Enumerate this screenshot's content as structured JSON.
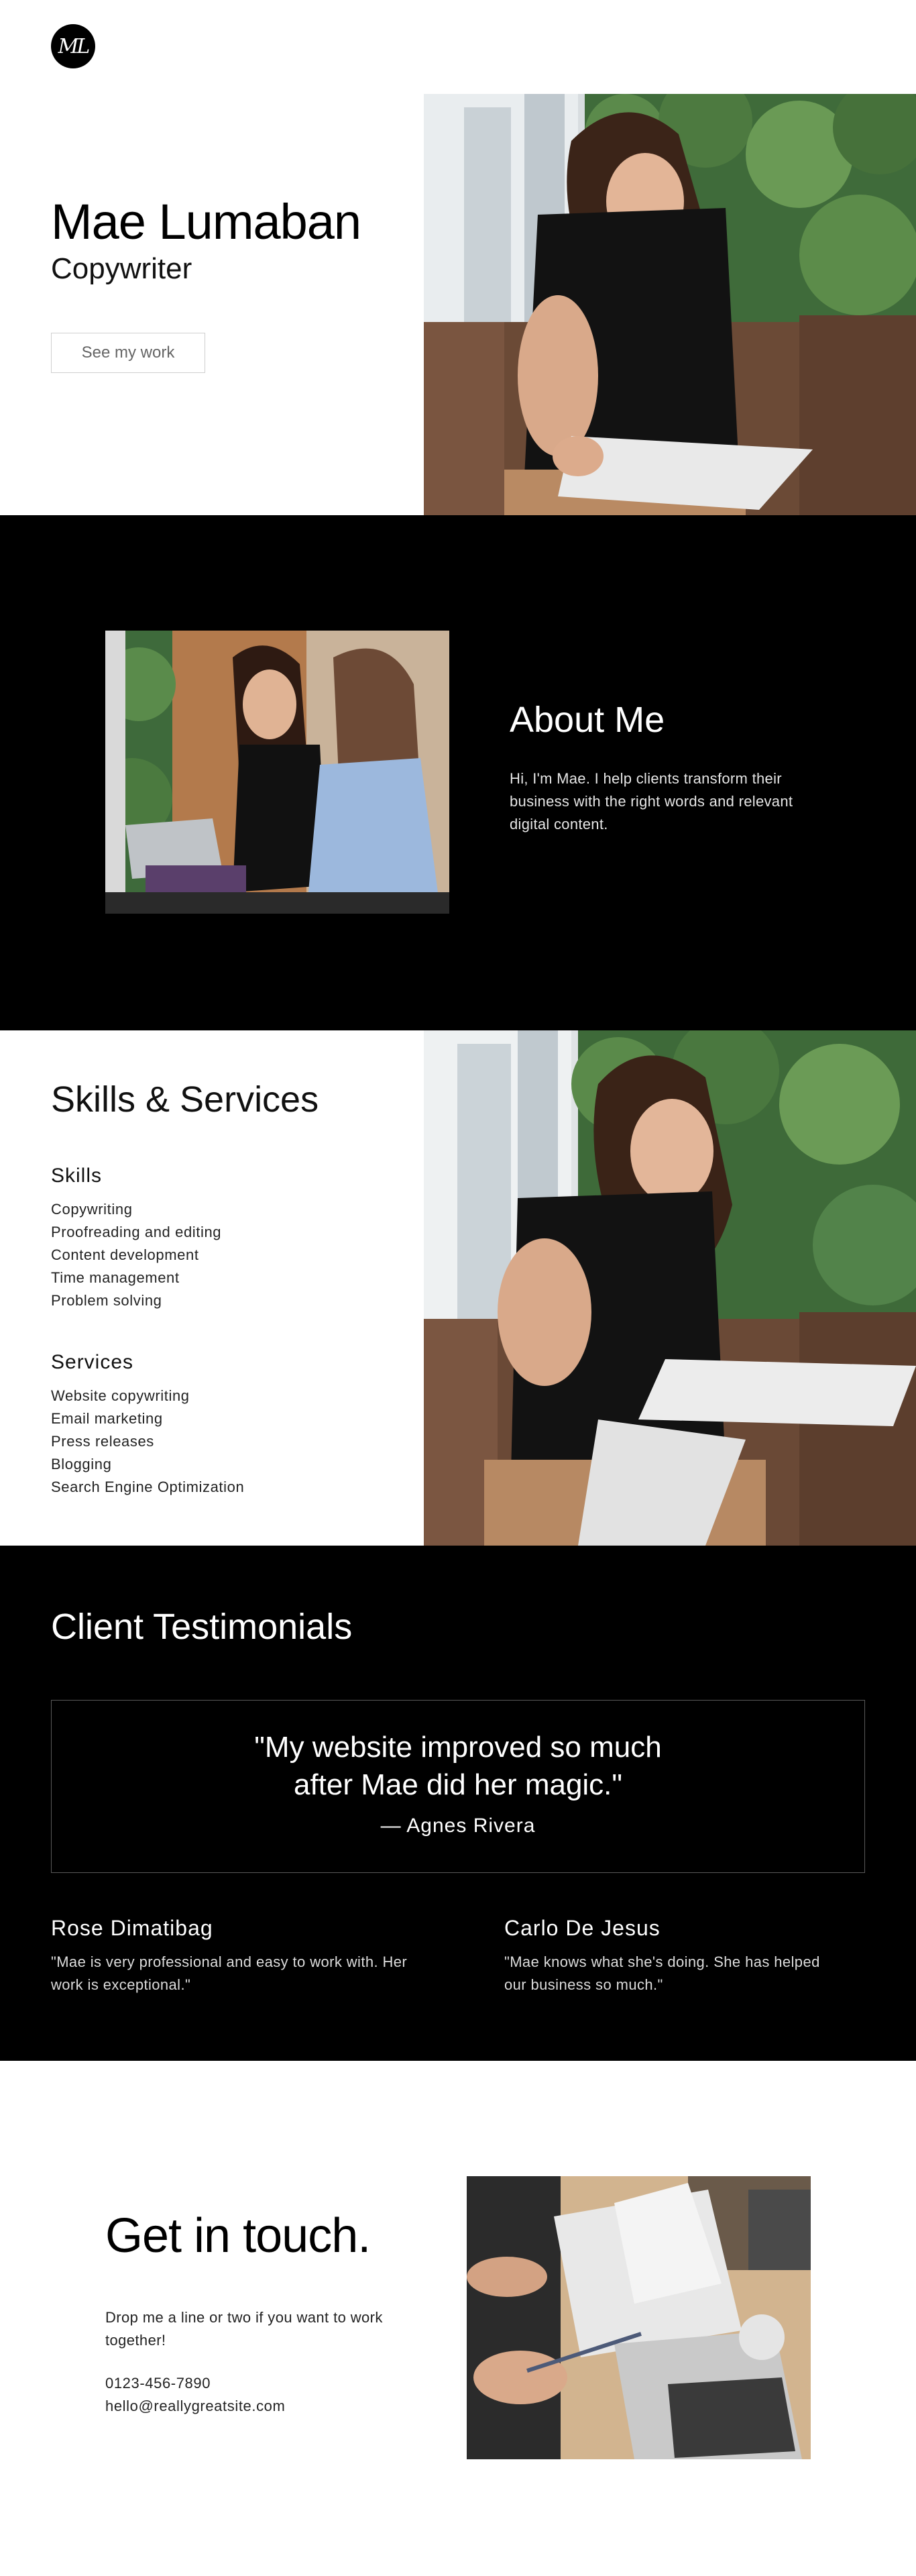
{
  "logo": {
    "monogram": "ML"
  },
  "hero": {
    "name": "Mae Lumaban",
    "role": "Copywriter",
    "button_label": "See my work"
  },
  "about": {
    "title": "About Me",
    "text": "Hi, I'm Mae. I help clients transform their business with the right words and relevant digital content."
  },
  "skills": {
    "title": "Skills & Services",
    "skills_heading": "Skills",
    "skills_list": [
      "Copywriting",
      "Proofreading and editing",
      "Content development",
      "Time management",
      "Problem solving"
    ],
    "services_heading": "Services",
    "services_list": [
      "Website copywriting",
      "Email marketing",
      "Press releases",
      "Blogging",
      "Search Engine Optimization"
    ]
  },
  "testimonials": {
    "title": "Client Testimonials",
    "featured": {
      "quote": "\"My website improved so much after Mae did her magic.\"",
      "author": "—  Agnes Rivera"
    },
    "items": [
      {
        "name": "Rose Dimatibag",
        "text": "\"Mae is very professional and easy to work with. Her work is exceptional.\""
      },
      {
        "name": "Carlo De Jesus",
        "text": "\"Mae knows what she's doing. She has helped our business so much.\""
      }
    ]
  },
  "contact": {
    "title": "Get in touch.",
    "text": "Drop me a line or two if you want to work together!",
    "phone": "0123-456-7890",
    "email": "hello@reallygreatsite.com"
  },
  "colors": {
    "dark_section": "#000000",
    "light_section": "#ffffff",
    "button_border": "#cfcfcf"
  }
}
